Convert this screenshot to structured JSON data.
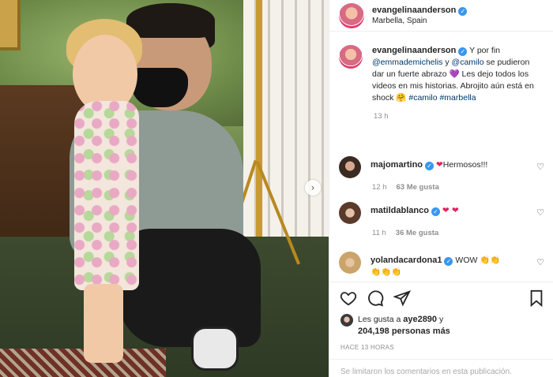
{
  "post": {
    "username": "evangelinaanderson",
    "location": "Marbella, Spain"
  },
  "caption": {
    "username": "evangelinaanderson",
    "text_1": "Y por fin",
    "mention_1": "@emmademichelis",
    "text_2": "y",
    "mention_2": "@camilo",
    "text_3": "se pudieron dar un fuerte abrazo",
    "emoji_1": "💜",
    "text_4": "Les dejo todos los videos en mis historias. Abrojito aún está en shock",
    "emoji_2": "🤗",
    "hashtag_1": "#camilo",
    "hashtag_2": "#marbella",
    "time": "13 h"
  },
  "comments": [
    {
      "username": "majomartino",
      "emoji": "❤",
      "text": "Hermosos!!!",
      "time": "12 h",
      "likes": "63 Me gusta"
    },
    {
      "username": "matildablanco",
      "emoji": "❤ ❤",
      "text": "",
      "time": "11 h",
      "likes": "36 Me gusta"
    },
    {
      "username": "yolandacardona1",
      "text": "WOW",
      "emoji_inline": "👏👏",
      "emoji_line2": "👏👏👏"
    }
  ],
  "actions": {
    "like_icon": "heart-icon",
    "comment_icon": "comment-icon",
    "share_icon": "send-icon",
    "save_icon": "bookmark-icon"
  },
  "likes": {
    "prefix": "Les gusta a",
    "user": "aye2890",
    "suffix": "y",
    "count": "204,198 personas más"
  },
  "time_ago": "HACE 13 HORAS",
  "comments_closed": "Se limitaron los comentarios en esta publicación."
}
